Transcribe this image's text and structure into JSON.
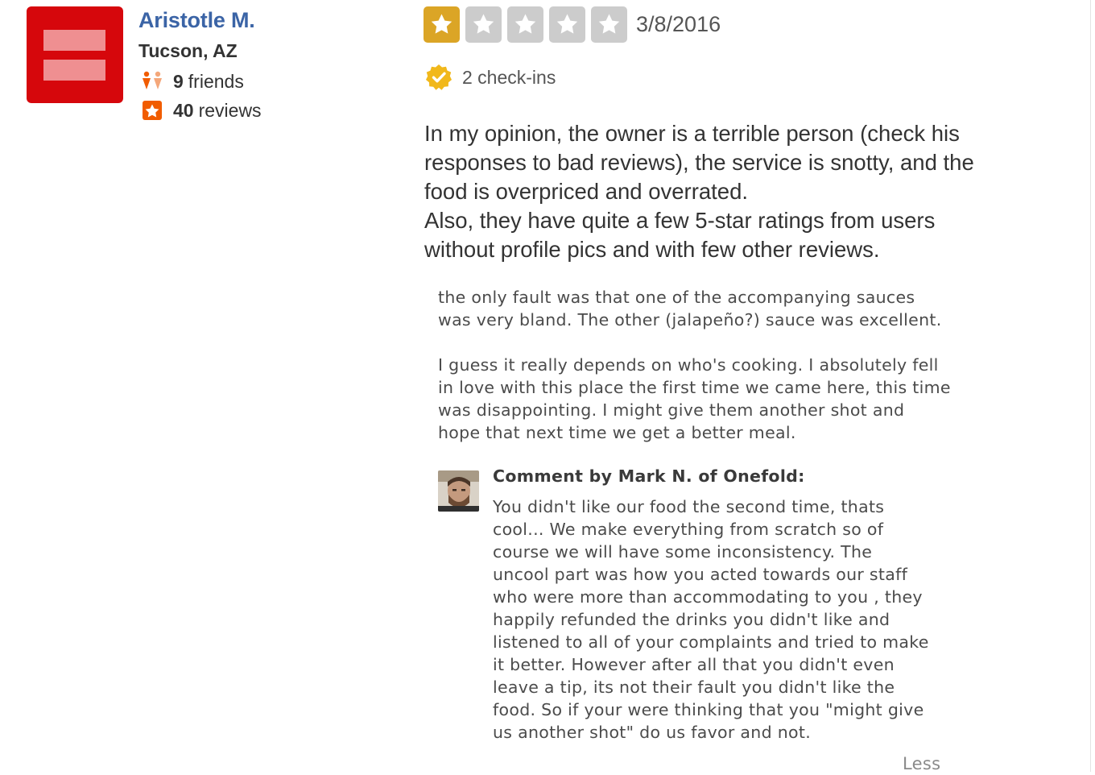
{
  "user": {
    "name": "Aristotle M.",
    "location": "Tucson, AZ",
    "friends_count": "9",
    "friends_label": "friends",
    "reviews_count": "40",
    "reviews_label": "reviews",
    "avatar_icon": "equality-logo",
    "friends_icon": "friends-icon",
    "reviews_icon": "review-star-icon"
  },
  "review": {
    "rating": 1,
    "max_rating": 5,
    "date": "3/8/2016",
    "checkin_icon": "checkin-badge-icon",
    "checkins": "2 check-ins",
    "lines": [
      "In my opinion, the owner is a terrible person (check his",
      "responses to bad reviews), the service is snotty, and the",
      "food is overpriced and overrated.",
      "Also, they have quite a few 5-star ratings from users",
      "without profile pics and with few other reviews."
    ]
  },
  "embedded_screenshot": {
    "paragraph1": [
      "the only fault was that one of the accompanying sauces",
      "was very bland. The other (jalapeño?) sauce was excellent."
    ],
    "paragraph2": [
      "I guess it really depends on who's cooking. I absolutely fell",
      "in love with this place the first time we came here, this time",
      "was disappointing. I might give them another shot and",
      "hope that next time we get a better meal."
    ],
    "comment_title": "Comment by Mark N. of Onefold:",
    "comment_lines": [
      "You didn't like our food the second time, thats",
      "cool... We make everything from scratch so of",
      "course we will have some inconsistency.  The",
      "uncool part was how you acted towards our staff",
      "who were more than accommodating to you , they",
      "happily refunded the drinks you didn't like and",
      "listened to all of your complaints and tried to make",
      "it better.  However after all that you didn't even",
      "leave a tip, its not their fault you didn't like the",
      "food.  So if your were thinking that you \"might give",
      "us another shot\" do us favor and not."
    ],
    "less_label": "Less"
  },
  "colors": {
    "user_name": "#3b64a6",
    "star_filled": "#dba526",
    "star_empty": "#cccccc",
    "avatar_bg": "#d6070c",
    "checkin_badge": "#f1b81b",
    "review_star_badge": "#f15c00"
  }
}
